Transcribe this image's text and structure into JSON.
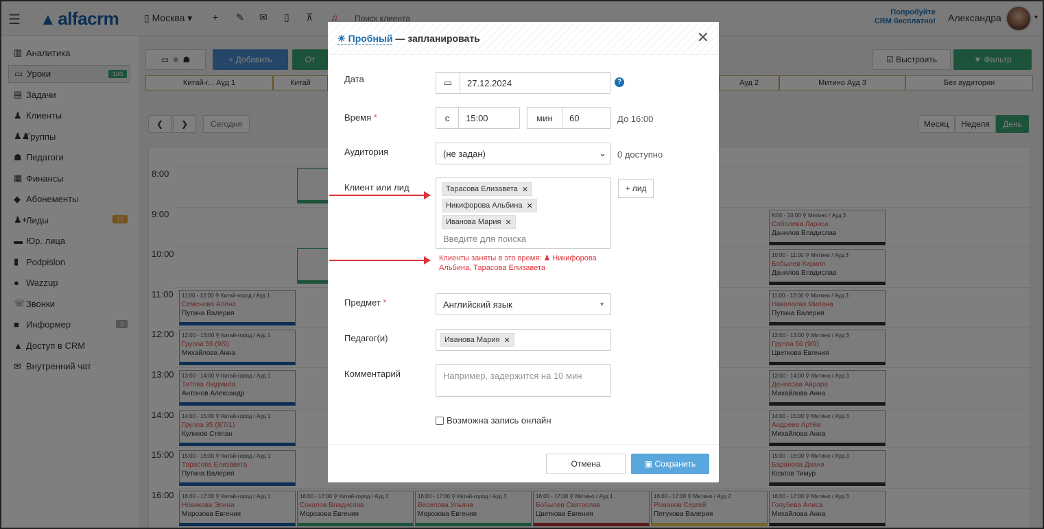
{
  "topbar": {
    "logo": "alfacrm",
    "city": "Москва",
    "search_placeholder": "Поиск клиента",
    "promo_line1": "Попробуйте",
    "promo_line2": "CRM бесплатно!",
    "user": "Александра"
  },
  "sidebar": {
    "items": [
      {
        "label": "Аналитика",
        "icon": "analytics-icon"
      },
      {
        "label": "Уроки",
        "icon": "calendar-icon",
        "badge": "100"
      },
      {
        "label": "Задачи",
        "icon": "tasks-icon"
      },
      {
        "label": "Клиенты",
        "icon": "user-icon"
      },
      {
        "label": "Группы",
        "icon": "group-icon"
      },
      {
        "label": "Педагоги",
        "icon": "graduation-cap-icon"
      },
      {
        "label": "Финансы",
        "icon": "money-icon"
      },
      {
        "label": "Абонементы",
        "icon": "tag-icon"
      },
      {
        "label": "Лиды",
        "icon": "user-plus-icon",
        "badge": "22"
      },
      {
        "label": "Юр. лица",
        "icon": "briefcase-icon"
      },
      {
        "label": "Podpislon",
        "icon": "file-icon"
      },
      {
        "label": "Wazzup",
        "icon": "whatsapp-icon"
      },
      {
        "label": "Звонки",
        "icon": "phone-icon"
      },
      {
        "label": "Информер",
        "icon": "informer-icon",
        "badge": "3"
      },
      {
        "label": "Доступ в CRM",
        "icon": "lock-icon"
      },
      {
        "label": "Внутренний чат",
        "icon": "chat-icon"
      }
    ]
  },
  "toolbar": {
    "add_label": "+ Добавить",
    "partial_label": "От",
    "build_label": "Выстроить",
    "filter_label": "Фильтр",
    "today_label": "Сегодня",
    "view_month": "Месяц",
    "view_week": "Неделя",
    "view_day": "День"
  },
  "rooms": [
    "Китай-г... Ауд 1",
    "Китай",
    "Ауд 2",
    "Митино Ауд 3",
    "Без аудитории"
  ],
  "times": [
    "8:00",
    "9:00",
    "10:00",
    "11:00",
    "12:00",
    "13:00",
    "14:00",
    "15:00",
    "16:00"
  ],
  "cards": [
    {
      "time": "11:00 - 12:00 ⚲ Китай-город / Ауд 1",
      "name": "Семенова Алёна",
      "teacher": "Путина Валерия"
    },
    {
      "time": "12:00 - 13:00 ⚲ Китай-город / Ауд 1",
      "name": "Группа 56 (9/9)",
      "teacher": "Михайлова Анна"
    },
    {
      "time": "13:00 - 14:00 ⚲ Китай-город / Ауд 1",
      "name": "Титова Людмила",
      "teacher": "Антонов Александр"
    },
    {
      "time": "14:00 - 15:00 ⚲ Китай-город / Ауд 1",
      "name": "Группа 35 (8/7/1)",
      "teacher": "Куликов Степан"
    },
    {
      "time": "15:00 - 16:00 ⚲ Китай-город / Ауд 1",
      "name": "Тарасова Елизавета",
      "teacher": "Путина Валерия"
    },
    {
      "time": "16:00 - 17:00 ⚲ Китай-город / Ауд 1",
      "name": "Новикова Элина",
      "teacher": "Морозова Евгения"
    },
    {
      "time": "16:00 - 17:00 ⚲ Китай-город / Ауд 2",
      "name": "Соколов Владислав",
      "teacher": "Морозова Евгения"
    },
    {
      "time": "16:00 - 17:00 ⚲ Китай-город / Ауд 3",
      "name": "Веселова Ульяна",
      "teacher": "Морозова Евгения"
    },
    {
      "time": "16:00 - 17:00 ⚲ Митино / Ауд 1",
      "name": "Бобылев Святослав",
      "teacher": "Цветкова Евгения"
    },
    {
      "time": "16:00 - 17:00 ⚲ Митино / Ауд 2",
      "name": "Романов Сергей",
      "teacher": "Петухова Валерия"
    },
    {
      "time": "9:00 - 10:00 ⚲ Митино / Ауд 3",
      "name": "Соболева Лариса",
      "teacher": "Данилов Владислав"
    },
    {
      "time": "10:00 - 11:00 ⚲ Митино / Ауд 3",
      "name": "Бобылев Кирилл",
      "teacher": "Данилов Владислав"
    },
    {
      "time": "11:00 - 12:00 ⚲ Митино / Ауд 3",
      "name": "Николаева Милана",
      "teacher": "Путина Валерия"
    },
    {
      "time": "12:00 - 13:00 ⚲ Митино / Ауд 3",
      "name": "Группа 56 (9/9)",
      "teacher": "Цветкова Евгения"
    },
    {
      "time": "13:00 - 14:00 ⚲ Митино / Ауд 3",
      "name": "Денисова Аврора",
      "teacher": "Михайлова Анна"
    },
    {
      "time": "14:00 - 15:00 ⚲ Митино / Ауд 3",
      "name": "Андреев Артём",
      "teacher": "Михайлова Анна"
    },
    {
      "time": "15:00 - 16:00 ⚲ Митино / Ауд 3",
      "name": "Баранова Диана",
      "teacher": "Козлов Тимур"
    },
    {
      "time": "16:00 - 17:00 ⚲ Митино / Ауд 3",
      "name": "Голубева Алиса",
      "teacher": "Михайлова Анна"
    }
  ],
  "modal": {
    "title_link": "Пробный",
    "title_rest": "— запланировать",
    "date_label": "Дата",
    "date_value": "27.12.2024",
    "time_label": "Время",
    "time_from_prefix": "с",
    "time_from": "15:00",
    "duration_prefix": "мин",
    "duration": "60",
    "time_to": "До 16:00",
    "room_label": "Аудитория",
    "room_value": "(не задан)",
    "room_available": "0 доступно",
    "client_label": "Клиент или лид",
    "clients": [
      "Тарасова Елизавета",
      "Никифорова Альбина",
      "Иванова Мария"
    ],
    "client_search_placeholder": "Введите для поиска",
    "add_lead": "+ лид",
    "warning": "Клиенты заняты в это время: ",
    "warning_names": "Никифорова Альбина, Тарасова Елизавета",
    "subject_label": "Предмет",
    "subject_value": "Английский язык",
    "teacher_label": "Педагог(и)",
    "teacher_value": "Иванова Мария",
    "comment_label": "Комментарий",
    "comment_placeholder": "Например, задержится на 10 мин",
    "online_label": "Возможна запись онлайн",
    "cancel": "Отмена",
    "save": "Сохранить"
  },
  "colors": {
    "accent": "#1a6fb0",
    "save": "#5aa7de",
    "warn": "#e0333a",
    "green": "#2f9a6a"
  }
}
